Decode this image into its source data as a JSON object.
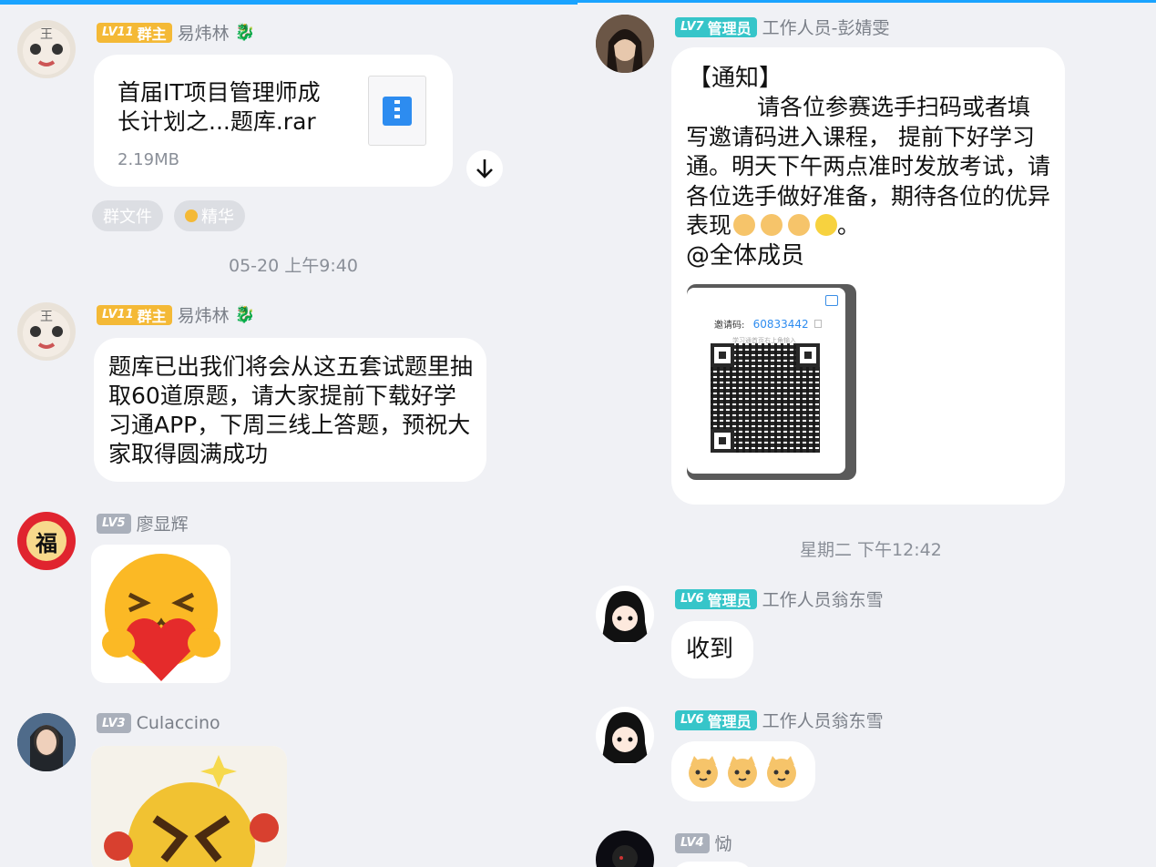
{
  "left": {
    "messages": [
      {
        "badge_level": "LV11",
        "badge_role": "群主",
        "sender": "易炜林",
        "file": {
          "name_line1": "首届IT项目管理师成",
          "name_line2": "长计划之...题库.rar",
          "size": "2.19MB"
        },
        "tags": [
          "群文件",
          "精华"
        ]
      },
      {
        "badge_level": "LV11",
        "badge_role": "群主",
        "sender": "易炜林",
        "text": "题库已出我们将会从这五套试题里抽取60道原题，请大家提前下载好学习通APP，下周三线上答题，预祝大家取得圆满成功"
      },
      {
        "badge_level": "LV5",
        "sender": "廖显辉",
        "sticker": "heart-hug-emoji"
      },
      {
        "badge_level": "LV3",
        "sender": "Culaccino",
        "sticker": "flower-face-emoji"
      }
    ],
    "timestamp": "05-20 上午9:40"
  },
  "right": {
    "notice": {
      "badge_level": "LV7",
      "badge_role": "管理员",
      "sender": "工作人员-彭婧雯",
      "title": "【通知】",
      "body": "请各位参赛选手扫码或者填写邀请码进入课程， 提前下好学习通。明天下午两点准时发放考试，请各位选手做好准备，期待各位的优异表现",
      "emoji_tail": "。",
      "mention": "@全体成员",
      "invite_label": "邀请码:",
      "invite_code": "60833442",
      "invite_hint": "学习通首页右上角输入"
    },
    "timestamp": "星期二 下午12:42",
    "messages": [
      {
        "badge_level": "LV6",
        "badge_role": "管理员",
        "sender": "工作人员翁东雪",
        "text": "收到"
      },
      {
        "badge_level": "LV6",
        "badge_role": "管理员",
        "sender": "工作人员翁东雪",
        "emoji": "cat-emoji x3"
      },
      {
        "badge_level": "LV4",
        "sender": "恸"
      }
    ]
  },
  "colors": {
    "accent_blue": "#1aa3ff",
    "gold": "#f4b936",
    "teal": "#36c5c9",
    "grey": "#aab0bb"
  }
}
